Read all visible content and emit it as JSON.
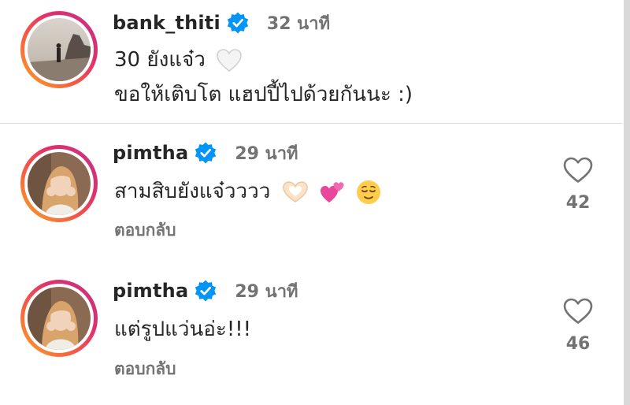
{
  "comments": [
    {
      "username": "bank_thiti",
      "verified": true,
      "time": "32 นาที",
      "lines": [
        "30 ยังแจ๋ว",
        "ขอให้เติบโต แฮปปี้ไปด้วยกันนะ :)"
      ],
      "emojis": [
        "white-heart-icon"
      ]
    },
    {
      "username": "pimtha",
      "verified": true,
      "time": "29 นาที",
      "text": "สามสิบยังแจ๋วววว",
      "emojis": [
        "heart-hands-icon",
        "two-hearts-icon",
        "relieved-face-icon"
      ],
      "reply": "ตอบกลับ",
      "likes": "42"
    },
    {
      "username": "pimtha",
      "verified": true,
      "time": "29 นาที",
      "text": "แต่รูปแว่นอ่ะ!!!",
      "reply": "ตอบกลับ",
      "likes": "46"
    }
  ],
  "colors": {
    "verified": "#0095f6",
    "muted": "#737373",
    "text": "#262626",
    "separator": "#dbdbdb"
  }
}
